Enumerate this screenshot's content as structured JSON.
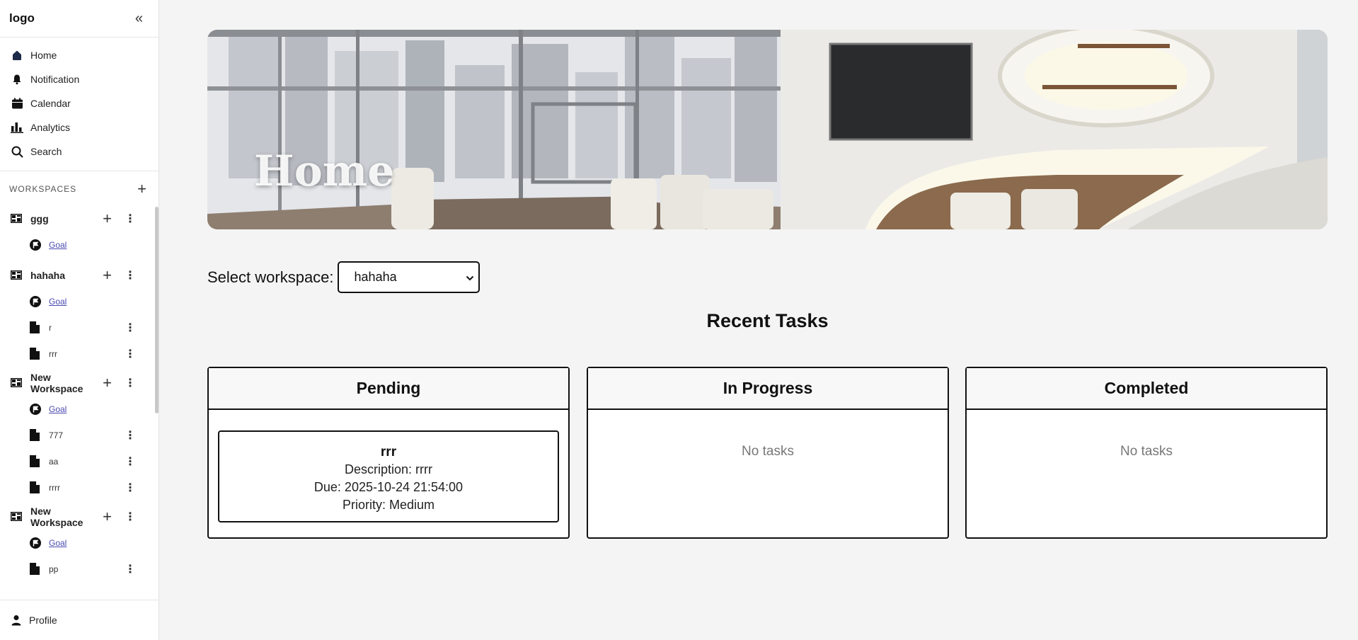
{
  "sidebar": {
    "logo": "logo",
    "collapse_icon": "double-chevron-left",
    "nav": [
      {
        "label": "Home",
        "icon": "home-icon"
      },
      {
        "label": "Notification",
        "icon": "bell-icon"
      },
      {
        "label": "Calendar",
        "icon": "calendar-icon"
      },
      {
        "label": "Analytics",
        "icon": "bar-chart-icon"
      },
      {
        "label": "Search",
        "icon": "search-icon"
      }
    ],
    "workspaces_title": "WORKSPACES",
    "workspaces": [
      {
        "name": "ggg",
        "items": [
          {
            "label": "Goal",
            "type": "goal"
          }
        ]
      },
      {
        "name": "hahaha",
        "items": [
          {
            "label": "Goal",
            "type": "goal"
          },
          {
            "label": "r",
            "type": "page"
          },
          {
            "label": "rrr",
            "type": "page"
          }
        ]
      },
      {
        "name": "New Workspace",
        "items": [
          {
            "label": "Goal",
            "type": "goal"
          },
          {
            "label": "777",
            "type": "page"
          },
          {
            "label": "aa",
            "type": "page"
          },
          {
            "label": "rrrr",
            "type": "page"
          }
        ]
      },
      {
        "name": "New Workspace",
        "items": [
          {
            "label": "Goal",
            "type": "goal"
          },
          {
            "label": "pp",
            "type": "page"
          }
        ]
      }
    ],
    "profile_label": "Profile"
  },
  "main": {
    "banner_title": "Home",
    "select_label": "Select workspace:",
    "selected_workspace": "hahaha",
    "recent_title": "Recent Tasks",
    "columns": {
      "pending": {
        "title": "Pending"
      },
      "in_progress": {
        "title": "In Progress",
        "empty": "No tasks"
      },
      "completed": {
        "title": "Completed",
        "empty": "No tasks"
      }
    },
    "task": {
      "title": "rrr",
      "description": "Description: rrrr",
      "due": "Due: 2025-10-24 21:54:00",
      "priority": "Priority: Medium"
    }
  }
}
